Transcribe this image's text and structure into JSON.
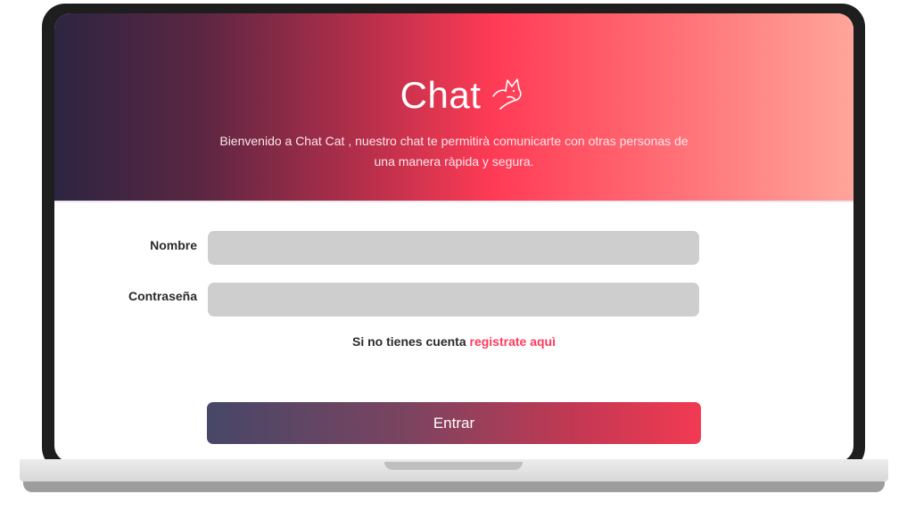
{
  "app": {
    "title": "Chat",
    "logo_icon": "cat-icon",
    "subtitle": "Bienvenido a Chat Cat , nuestro chat te permitirà comunicarte con otras personas de una manera ràpida y segura."
  },
  "form": {
    "username_label": "Nombre",
    "username_value": "",
    "password_label": "Contraseña",
    "password_value": "",
    "register_prompt": "Si no tienes cuenta",
    "register_link": "registrate aquì",
    "submit_label": "Entrar"
  },
  "colors": {
    "accent": "#ff3b5c",
    "gradient_dark": "#2c2542",
    "gradient_mid": "#ff3b55",
    "gradient_light": "#ffa59a",
    "field_bg": "#cecece",
    "button_start": "#474768",
    "button_end": "#f23a52"
  }
}
